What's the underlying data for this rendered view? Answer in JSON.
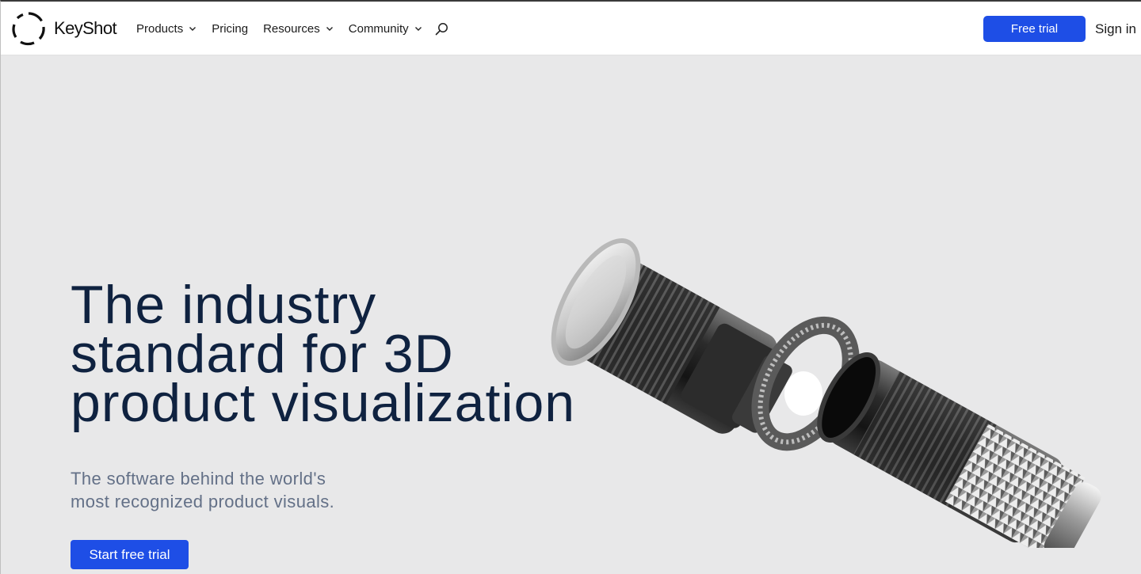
{
  "nav": {
    "logo_text": "KeyShot",
    "logo_icon": "keyshot-logo-icon",
    "items": [
      {
        "label": "Products",
        "has_dropdown": true
      },
      {
        "label": "Pricing",
        "has_dropdown": false
      },
      {
        "label": "Resources",
        "has_dropdown": true
      },
      {
        "label": "Community",
        "has_dropdown": true
      }
    ],
    "search_icon": "search-icon",
    "cta_label": "Free trial",
    "signin_label": "Sign in"
  },
  "hero": {
    "title_lines": [
      "The industry",
      "standard for 3D",
      "product visualization"
    ],
    "subtitle_lines": [
      "The software behind the world's",
      "most recognized product visuals."
    ],
    "cta_label": "Start free trial",
    "image": "exploded-flashlight-render"
  },
  "colors": {
    "accent": "#1e4ee6",
    "title": "#0f2240",
    "subtitle": "#637087",
    "background": "#e8e8e9"
  }
}
